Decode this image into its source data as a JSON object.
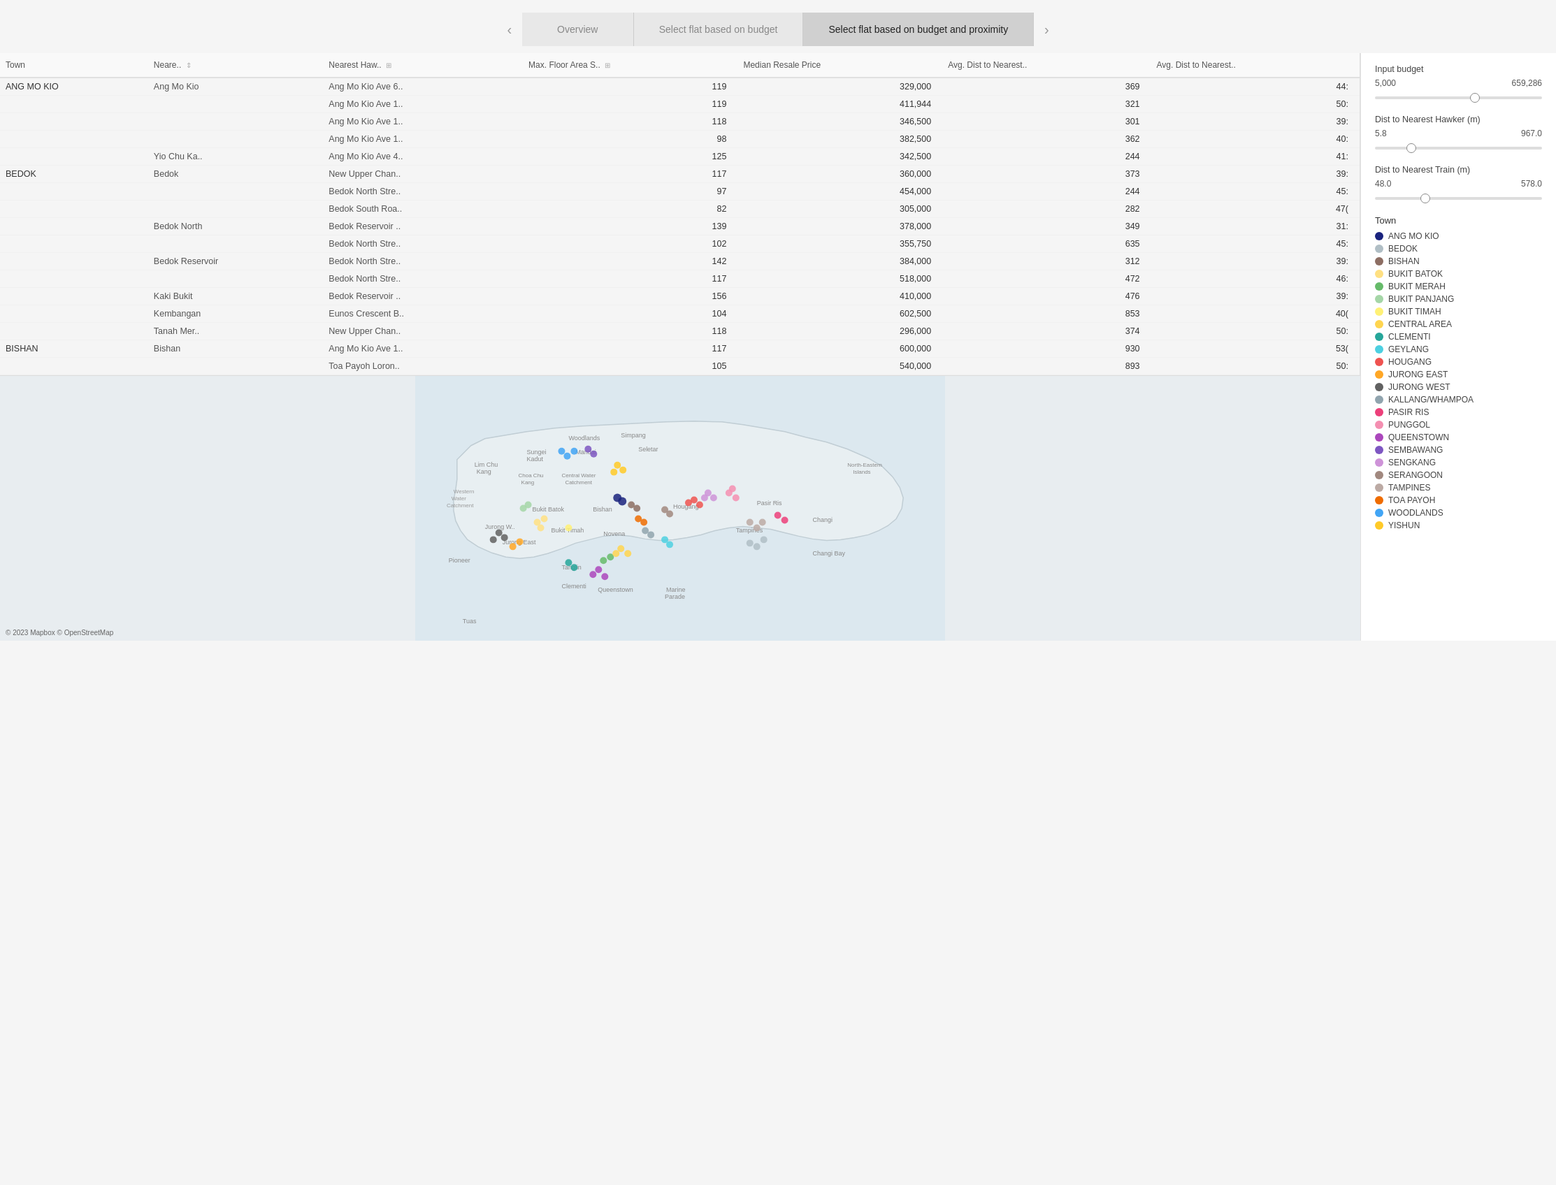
{
  "nav": {
    "tabs": [
      {
        "id": "overview",
        "label": "Overview",
        "active": false
      },
      {
        "id": "budget",
        "label": "Select flat based on budget",
        "active": false
      },
      {
        "id": "proximity",
        "label": "Select flat based on budget and proximity",
        "active": true
      }
    ],
    "prev_label": "‹",
    "next_label": "›"
  },
  "controls": {
    "budget": {
      "label": "Input budget",
      "min": 5000,
      "max": 659286,
      "value_min_display": "5,000",
      "value_max_display": "659,286"
    },
    "hawker": {
      "label": "Dist to Nearest Hawker (m)",
      "min": 5.8,
      "max": 967.0,
      "value_min_display": "5.8",
      "value_max_display": "967.0"
    },
    "train": {
      "label": "Dist to Nearest Train (m)",
      "min": 48.0,
      "max": 578.0,
      "value_min_display": "48.0",
      "value_max_display": "578.0"
    }
  },
  "legend": {
    "title": "Town",
    "items": [
      {
        "name": "ANG MO KIO",
        "color": "#1a237e"
      },
      {
        "name": "BEDOK",
        "color": "#b0bec5"
      },
      {
        "name": "BISHAN",
        "color": "#8d6e63"
      },
      {
        "name": "BUKIT BATOK",
        "color": "#ffe082"
      },
      {
        "name": "BUKIT MERAH",
        "color": "#66bb6a"
      },
      {
        "name": "BUKIT PANJANG",
        "color": "#a5d6a7"
      },
      {
        "name": "BUKIT TIMAH",
        "color": "#fff176"
      },
      {
        "name": "CENTRAL AREA",
        "color": "#ffd54f"
      },
      {
        "name": "CLEMENTI",
        "color": "#26a69a"
      },
      {
        "name": "GEYLANG",
        "color": "#4dd0e1"
      },
      {
        "name": "HOUGANG",
        "color": "#ef5350"
      },
      {
        "name": "JURONG EAST",
        "color": "#ffa726"
      },
      {
        "name": "JURONG WEST",
        "color": "#616161"
      },
      {
        "name": "KALLANG/WHAMPOA",
        "color": "#90a4ae"
      },
      {
        "name": "PASIR RIS",
        "color": "#ec407a"
      },
      {
        "name": "PUNGGOL",
        "color": "#f48fb1"
      },
      {
        "name": "QUEENSTOWN",
        "color": "#ab47bc"
      },
      {
        "name": "SEMBAWANG",
        "color": "#7e57c2"
      },
      {
        "name": "SENGKANG",
        "color": "#ce93d8"
      },
      {
        "name": "SERANGOON",
        "color": "#a1887f"
      },
      {
        "name": "TAMPINES",
        "color": "#bcaaa4"
      },
      {
        "name": "TOA PAYOH",
        "color": "#ef6c00"
      },
      {
        "name": "WOODLANDS",
        "color": "#42a5f5"
      },
      {
        "name": "YISHUN",
        "color": "#ffca28"
      }
    ]
  },
  "table": {
    "headers": [
      "Town",
      "Neare.. ⇕",
      "Nearest Haw.. ⊞",
      "Max. Floor Area S.. ⊞",
      "Median Resale Price",
      "Avg. Dist to Nearest..",
      "Avg. Dist to Nearest.."
    ],
    "rows": [
      {
        "town": "ANG MO KIO",
        "nearest": "Ang Mo Kio",
        "hawker": "Ang Mo Kio Ave 6..",
        "floor": "119",
        "price": "329,000",
        "dist_hawker": "369",
        "dist_train": "44:"
      },
      {
        "town": "",
        "nearest": "",
        "hawker": "Ang Mo Kio Ave 1..",
        "floor": "119",
        "price": "411,944",
        "dist_hawker": "321",
        "dist_train": "50:"
      },
      {
        "town": "",
        "nearest": "",
        "hawker": "Ang Mo Kio Ave 1..",
        "floor": "118",
        "price": "346,500",
        "dist_hawker": "301",
        "dist_train": "39:"
      },
      {
        "town": "",
        "nearest": "",
        "hawker": "Ang Mo Kio Ave 1..",
        "floor": "98",
        "price": "382,500",
        "dist_hawker": "362",
        "dist_train": "40:"
      },
      {
        "town": "",
        "nearest": "Yio Chu Ka..",
        "hawker": "Ang Mo Kio Ave 4..",
        "floor": "125",
        "price": "342,500",
        "dist_hawker": "244",
        "dist_train": "41:"
      },
      {
        "town": "BEDOK",
        "nearest": "Bedok",
        "hawker": "New Upper Chan..",
        "floor": "117",
        "price": "360,000",
        "dist_hawker": "373",
        "dist_train": "39:"
      },
      {
        "town": "",
        "nearest": "",
        "hawker": "Bedok North Stre..",
        "floor": "97",
        "price": "454,000",
        "dist_hawker": "244",
        "dist_train": "45:"
      },
      {
        "town": "",
        "nearest": "",
        "hawker": "Bedok South Roa..",
        "floor": "82",
        "price": "305,000",
        "dist_hawker": "282",
        "dist_train": "47("
      },
      {
        "town": "",
        "nearest": "Bedok North",
        "hawker": "Bedok Reservoir ..",
        "floor": "139",
        "price": "378,000",
        "dist_hawker": "349",
        "dist_train": "31:"
      },
      {
        "town": "",
        "nearest": "",
        "hawker": "Bedok North Stre..",
        "floor": "102",
        "price": "355,750",
        "dist_hawker": "635",
        "dist_train": "45:"
      },
      {
        "town": "",
        "nearest": "Bedok Reservoir",
        "hawker": "Bedok North Stre..",
        "floor": "142",
        "price": "384,000",
        "dist_hawker": "312",
        "dist_train": "39:"
      },
      {
        "town": "",
        "nearest": "",
        "hawker": "Bedok North Stre..",
        "floor": "117",
        "price": "518,000",
        "dist_hawker": "472",
        "dist_train": "46:"
      },
      {
        "town": "",
        "nearest": "Kaki Bukit",
        "hawker": "Bedok Reservoir ..",
        "floor": "156",
        "price": "410,000",
        "dist_hawker": "476",
        "dist_train": "39:"
      },
      {
        "town": "",
        "nearest": "Kembangan",
        "hawker": "Eunos Crescent B..",
        "floor": "104",
        "price": "602,500",
        "dist_hawker": "853",
        "dist_train": "40("
      },
      {
        "town": "",
        "nearest": "Tanah Mer..",
        "hawker": "New Upper Chan..",
        "floor": "118",
        "price": "296,000",
        "dist_hawker": "374",
        "dist_train": "50:"
      },
      {
        "town": "BISHAN",
        "nearest": "Bishan",
        "hawker": "Ang Mo Kio Ave 1..",
        "floor": "117",
        "price": "600,000",
        "dist_hawker": "930",
        "dist_train": "53("
      },
      {
        "town": "",
        "nearest": "",
        "hawker": "Toa Payoh Loron..",
        "floor": "105",
        "price": "540,000",
        "dist_hawker": "893",
        "dist_train": "50:"
      }
    ]
  },
  "map": {
    "copyright": "© 2023 Mapbox  © OpenStreetMap",
    "labels": [
      "Lim Chu Kang",
      "Woodlands",
      "Simpang",
      "Sungei Kadut",
      "Mandai",
      "Seletar",
      "Western Water Catchment",
      "Choa Chu Kang",
      "Central Water Catchment",
      "North-Eastern Islands",
      "Bukit Batok",
      "Bishan",
      "Hougang",
      "Pasir Ris",
      "Jurong W..",
      "Jurong East",
      "Bukit Timah",
      "Novena",
      "Tampines",
      "Changi",
      "Pioneer",
      "Tanglin",
      "Clementi",
      "Queenstown",
      "Marine Parade",
      "Changi Bay",
      "Tuas"
    ]
  }
}
